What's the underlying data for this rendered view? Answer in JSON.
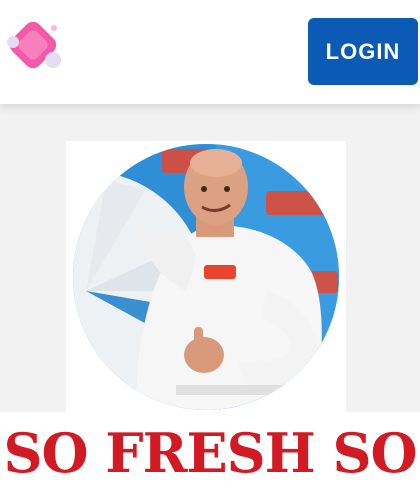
{
  "header": {
    "logo_icon": "pink-diamond-logo-icon",
    "login_label": "LOGIN"
  },
  "hero": {
    "image_icon": "man-in-white-shirt-thumbs-up-photo",
    "headline": "SO FRESH SO"
  },
  "colors": {
    "header_bg": "#ffffff",
    "page_bg": "#f2f2f2",
    "login_bg": "#0b5bb5",
    "headline_color": "#d11a24",
    "logo_pink": "#f25aa8"
  }
}
